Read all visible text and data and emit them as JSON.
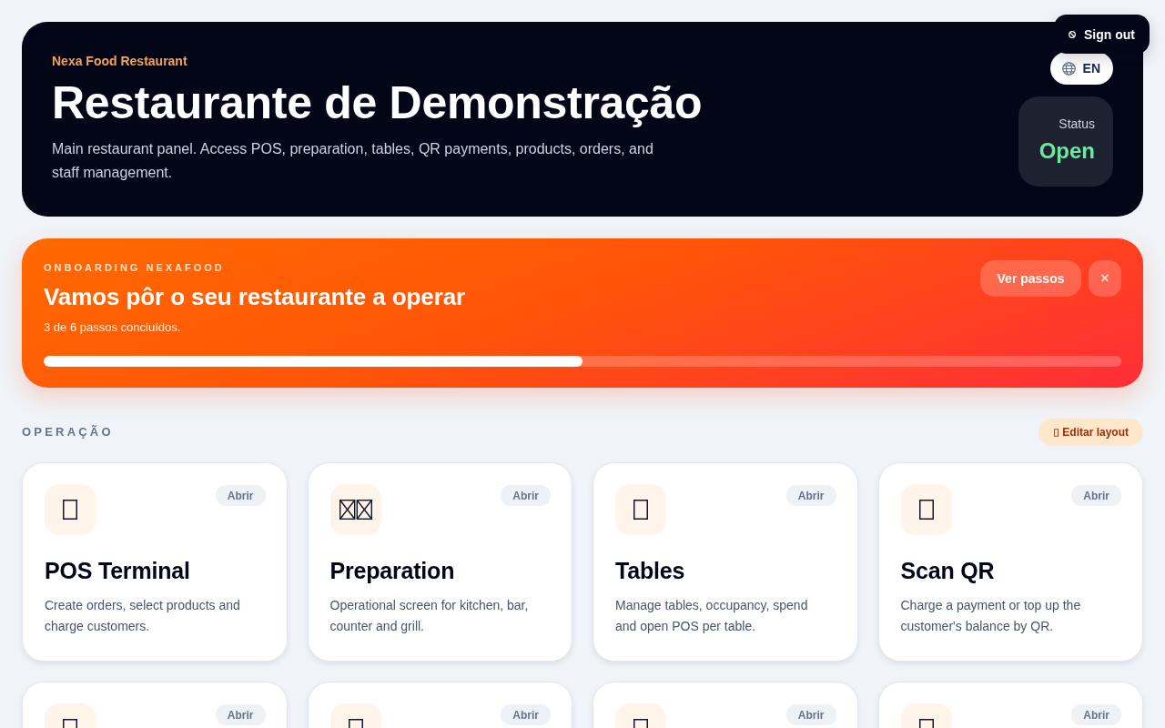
{
  "header": {
    "brand": "Nexa Food Restaurant",
    "title": "Restaurante de Demonstração",
    "description": "Main restaurant panel. Access POS, preparation, tables, QR payments, products, orders, and staff management.",
    "language_button": "EN",
    "status": {
      "label": "Status",
      "value": "Open"
    }
  },
  "sign_out_button": "Sign out",
  "onboarding": {
    "eyebrow": "ONBOARDING NEXAFOOD",
    "title": "Vamos pôr o seu restaurante a operar",
    "progress_text": "3 de 6 passos concluídos.",
    "level": 0.5,
    "buttons": [
      {
        "label": "Ver passos",
        "kind": "labeled"
      },
      {
        "label": "×",
        "kind": "close"
      }
    ]
  },
  "section": {
    "title": "OPERAÇÃO",
    "edit_button": "Editar layout",
    "cards": [
      {
        "title": "POS Terminal",
        "description": "Create orders, select products and charge customers.",
        "action": "Abrir"
      },
      {
        "title": "Preparation",
        "description": "Operational screen for kitchen, bar, counter and grill.",
        "action": "Abrir"
      },
      {
        "title": "Tables",
        "description": "Manage tables, occupancy, spend and open POS per table.",
        "action": "Abrir"
      },
      {
        "title": "Scan QR",
        "description": "Charge a payment or top up the customer's balance by QR.",
        "action": "Abrir"
      },
      {
        "action": "Abrir"
      },
      {
        "action": "Abrir"
      },
      {
        "action": "Abrir"
      },
      {
        "action": "Abrir"
      }
    ]
  }
}
